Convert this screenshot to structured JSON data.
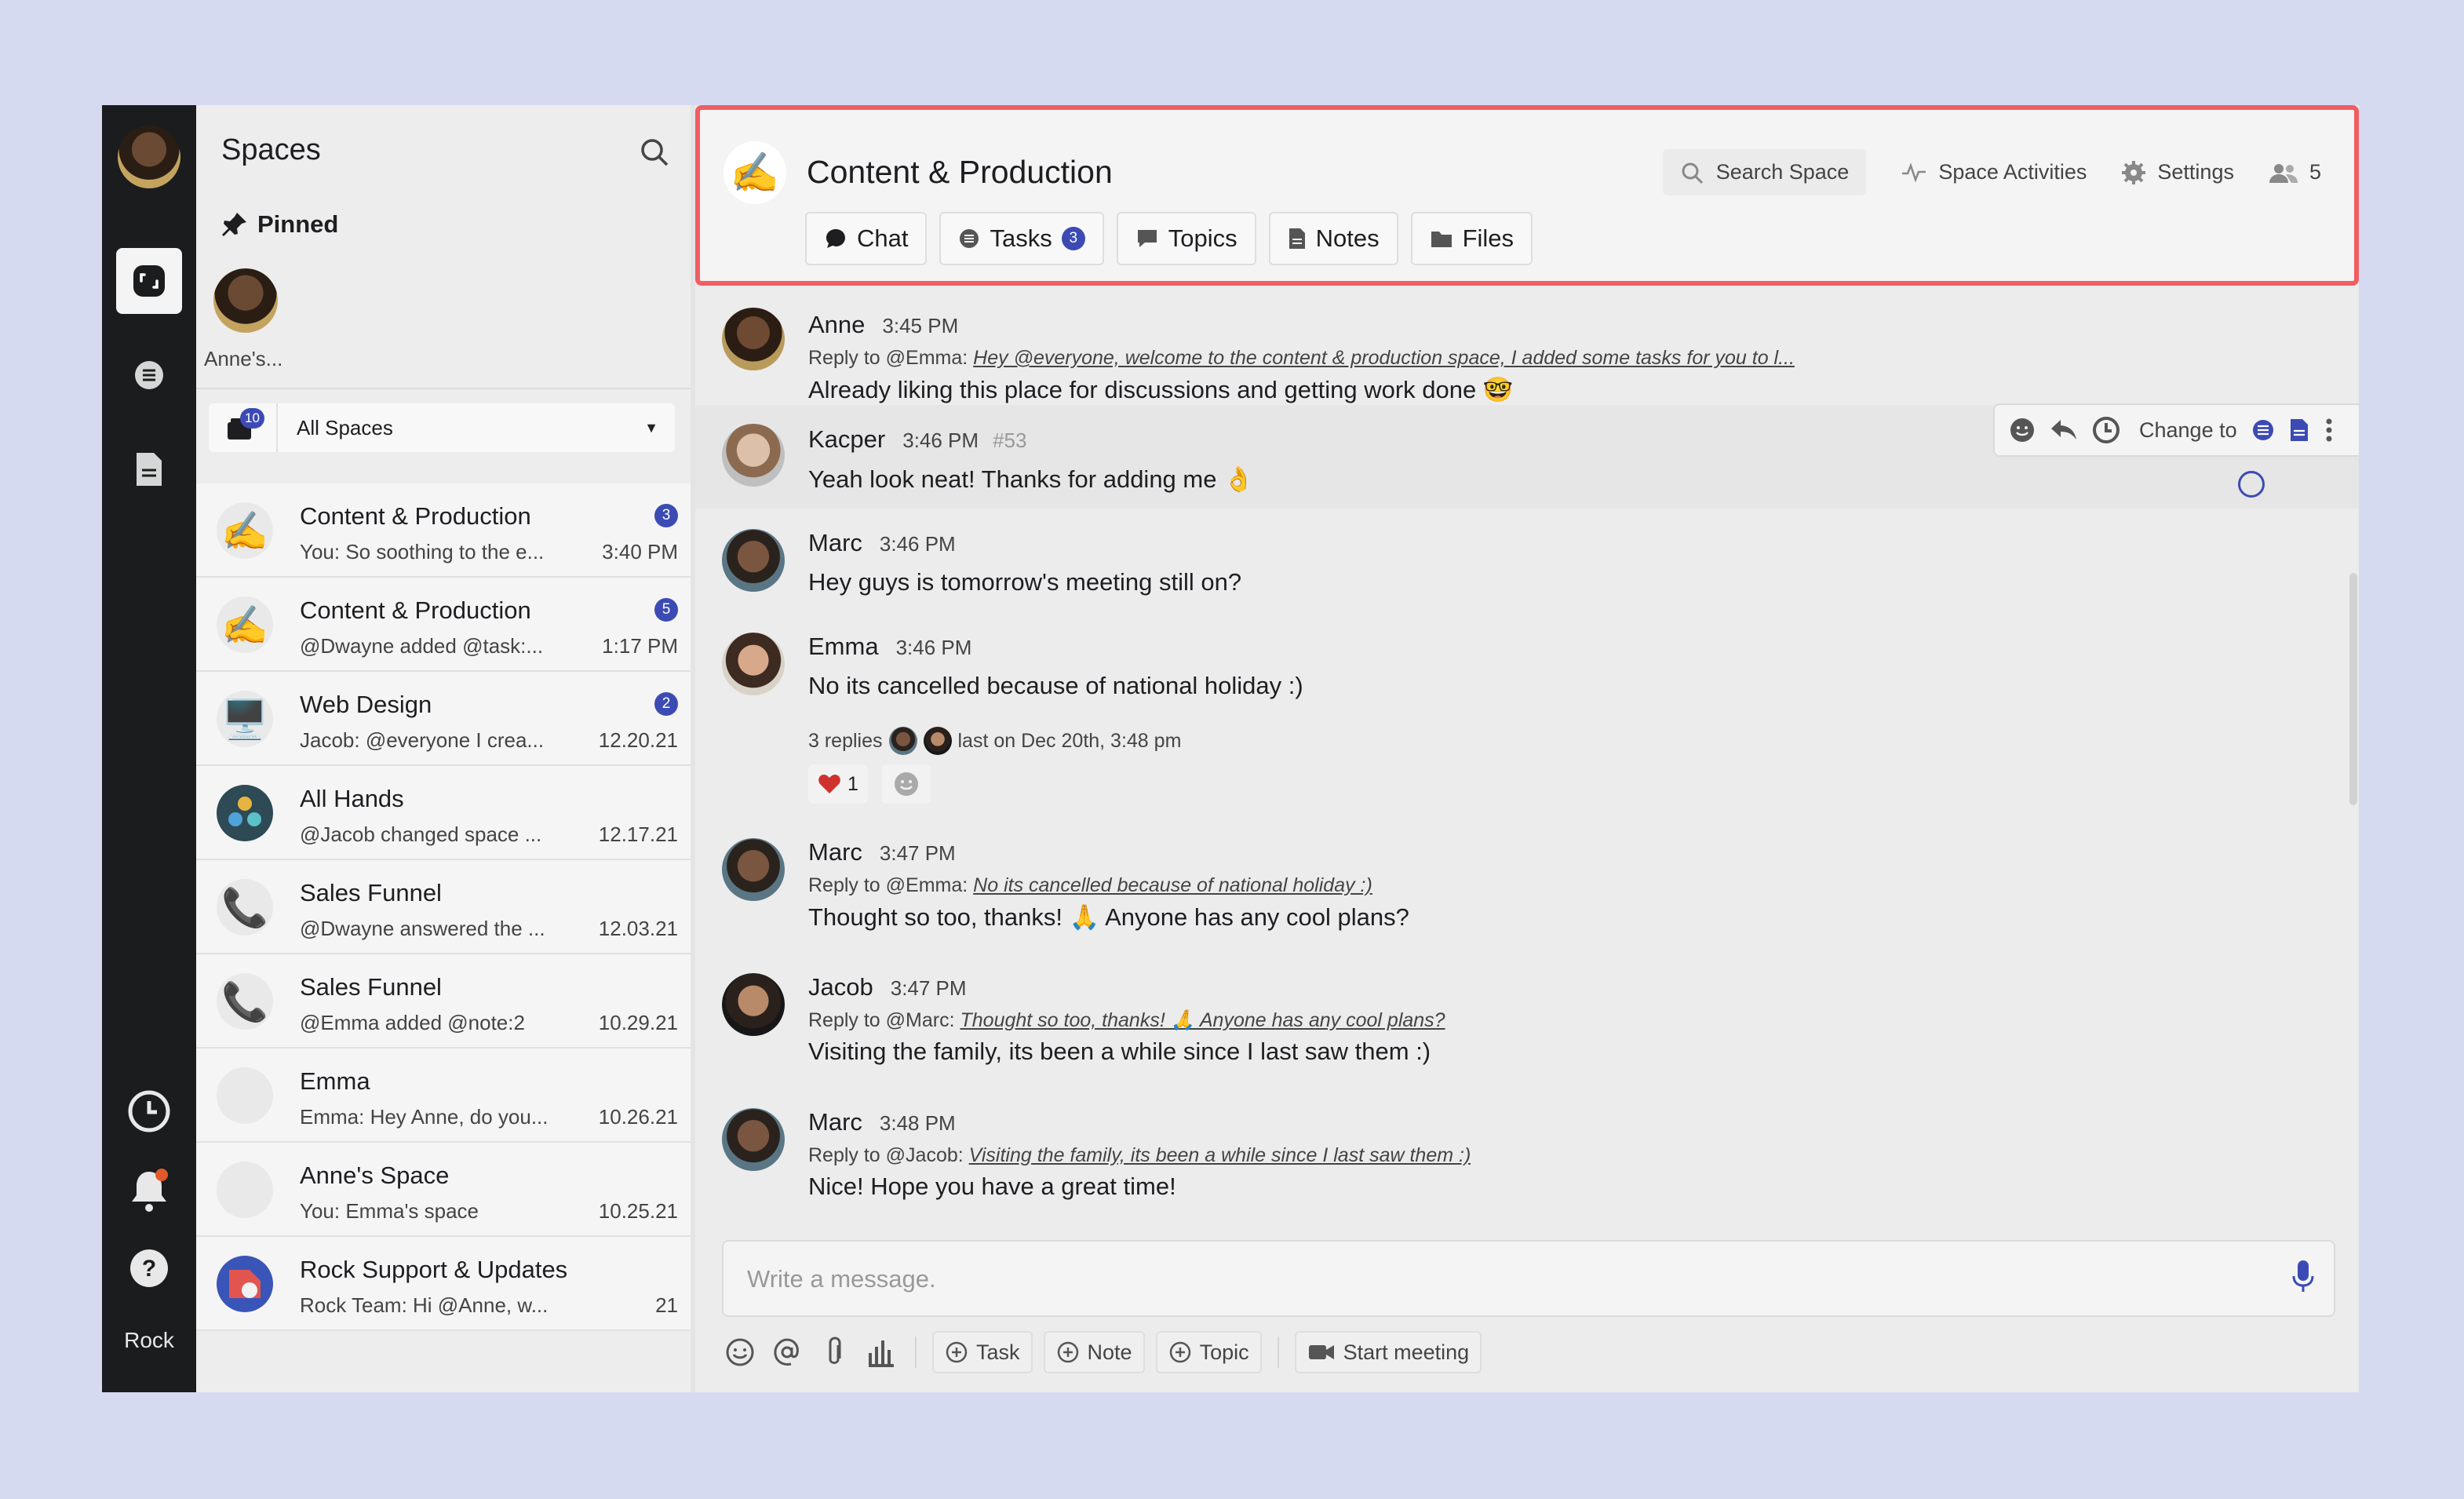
{
  "rail": {
    "label": "Rock"
  },
  "spaces": {
    "title": "Spaces",
    "pinned_title": "Pinned",
    "pinned_name": "Anne's...",
    "filter": {
      "label": "All Spaces",
      "badge": "10"
    },
    "items": [
      {
        "name": "Content & Production",
        "preview": "You: So soothing to the e...",
        "time": "3:40 PM",
        "badge": "3",
        "icon": "✍️"
      },
      {
        "name": "Content & Production",
        "preview": "@Dwayne added @task:...",
        "time": "1:17 PM",
        "badge": "5",
        "icon": "✍️"
      },
      {
        "name": "Web Design",
        "preview": "Jacob: @everyone I crea...",
        "time": "12.20.21",
        "badge": "2",
        "icon": "🖥️"
      },
      {
        "name": "All Hands",
        "preview": "@Jacob changed space ...",
        "time": "12.17.21",
        "badge": "",
        "icon": "group"
      },
      {
        "name": "Sales Funnel",
        "preview": "@Dwayne answered the ...",
        "time": "12.03.21",
        "badge": "",
        "icon": "📞"
      },
      {
        "name": "Sales Funnel",
        "preview": "@Emma added @note:2",
        "time": "10.29.21",
        "badge": "",
        "icon": "📞"
      },
      {
        "name": "Emma",
        "preview": "Emma: Hey Anne, do you...",
        "time": "10.26.21",
        "badge": "",
        "icon": "emma"
      },
      {
        "name": "Anne's Space",
        "preview": "You: Emma's space",
        "time": "10.25.21",
        "badge": "",
        "icon": "anne"
      },
      {
        "name": "Rock Support & Updates",
        "preview": "Rock Team: Hi @Anne, w...",
        "time": "21",
        "badge": "",
        "icon": "rock"
      }
    ],
    "fab_label": "+"
  },
  "header": {
    "emoji": "✍️",
    "title": "Content & Production",
    "search_label": "Search Space",
    "activities_label": "Space Activities",
    "settings_label": "Settings",
    "members_count": "5",
    "tabs": [
      {
        "label": "Chat",
        "badge": ""
      },
      {
        "label": "Tasks",
        "badge": "3"
      },
      {
        "label": "Topics",
        "badge": ""
      },
      {
        "label": "Notes",
        "badge": ""
      },
      {
        "label": "Files",
        "badge": ""
      }
    ]
  },
  "messages": [
    {
      "name": "Anne",
      "time": "3:45 PM",
      "reply_prefix": "Reply to @Emma:",
      "reply_text": "Hey @everyone, welcome to the content & production space, I added some tasks for you to l...",
      "text": "Already liking this place for discussions and getting work done 🤓"
    },
    {
      "name": "Kacper",
      "time": "3:46 PM",
      "ref": "#53",
      "text": "Yeah look neat! Thanks for adding me 👌"
    },
    {
      "name": "Marc",
      "time": "3:46 PM",
      "text": "Hey guys is tomorrow's meeting still on?"
    },
    {
      "name": "Emma",
      "time": "3:46 PM",
      "text": "No its cancelled because of national holiday :)",
      "thread_count": "3 replies",
      "thread_last": "last on Dec 20th, 3:48 pm",
      "reaction_count": "1"
    },
    {
      "name": "Marc",
      "time": "3:47 PM",
      "reply_prefix": "Reply to @Emma:",
      "reply_text": "No its cancelled because of national holiday :)",
      "text": "Thought so too, thanks! 🙏 Anyone has any cool plans?"
    },
    {
      "name": "Jacob",
      "time": "3:47 PM",
      "reply_prefix": "Reply to @Marc:",
      "reply_text": "Thought so too, thanks! 🙏 Anyone has any cool plans?",
      "text": "Visiting the family, its been a while since I last saw them :)"
    },
    {
      "name": "Marc",
      "time": "3:48 PM",
      "reply_prefix": "Reply to @Jacob:",
      "reply_text": "Visiting the family, its been a while since I last saw them :)",
      "text": "Nice! Hope you have a great time!"
    }
  ],
  "hover_tools": {
    "label": "Change to"
  },
  "composer": {
    "placeholder": "Write a message.",
    "task_label": "Task",
    "note_label": "Note",
    "topic_label": "Topic",
    "meeting_label": "Start meeting"
  },
  "colors": {
    "accent": "#3c4bb4",
    "header_border": "#f05d63",
    "rail": "#1b1c1e"
  }
}
